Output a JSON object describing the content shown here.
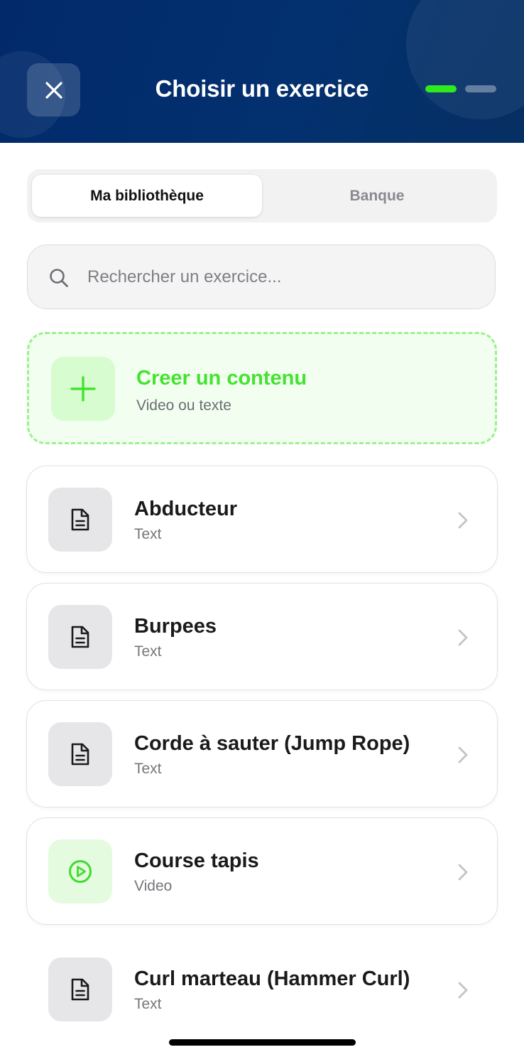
{
  "header": {
    "title": "Choisir un exercice",
    "close_icon": "close-icon",
    "steps": [
      {
        "active": true
      },
      {
        "active": false
      }
    ],
    "accent_color": "#2fea1f",
    "background_color": "#03306f"
  },
  "tabs": [
    {
      "label": "Ma bibliothèque",
      "active": true
    },
    {
      "label": "Banque",
      "active": false
    }
  ],
  "search": {
    "placeholder": "Rechercher un exercice...",
    "value": "",
    "icon": "search-icon"
  },
  "create": {
    "title": "Creer un contenu",
    "subtitle": "Video ou texte",
    "icon": "plus-icon",
    "color": "#43e32f"
  },
  "exercises": [
    {
      "title": "Abducteur",
      "type": "Text",
      "icon": "document-icon"
    },
    {
      "title": "Burpees",
      "type": "Text",
      "icon": "document-icon"
    },
    {
      "title": "Corde à sauter (Jump Rope)",
      "type": "Text",
      "icon": "document-icon"
    },
    {
      "title": "Course tapis",
      "type": "Video",
      "icon": "play-circle-icon"
    },
    {
      "title": "Curl marteau (Hammer Curl)",
      "type": "Text",
      "icon": "document-icon"
    }
  ]
}
